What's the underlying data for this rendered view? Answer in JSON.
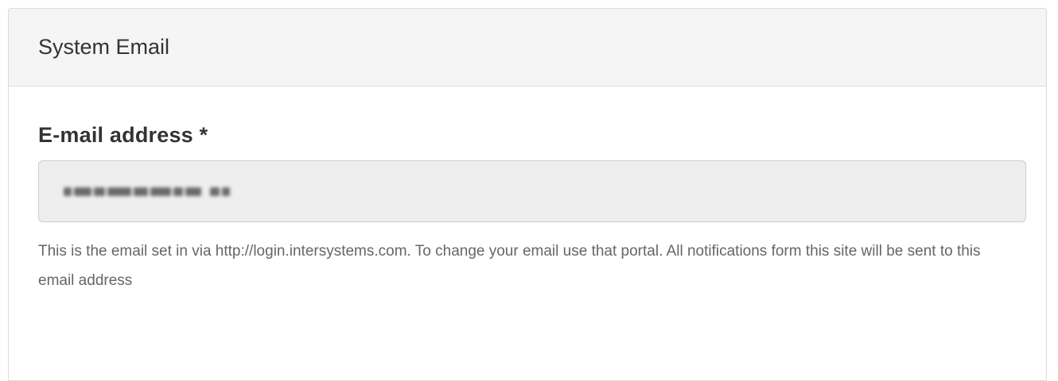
{
  "panel": {
    "title": "System Email"
  },
  "form": {
    "email_label": "E-mail address *",
    "email_value": "",
    "email_value_redacted": true,
    "help_text": "This is the email set in via http://login.intersystems.com. To change your email use that portal. All notifications form this site will be sent to this email address"
  },
  "colors": {
    "heading_background": "#f5f5f5",
    "input_background": "#eeeeee",
    "label_text": "#333333",
    "help_text": "#666666"
  }
}
